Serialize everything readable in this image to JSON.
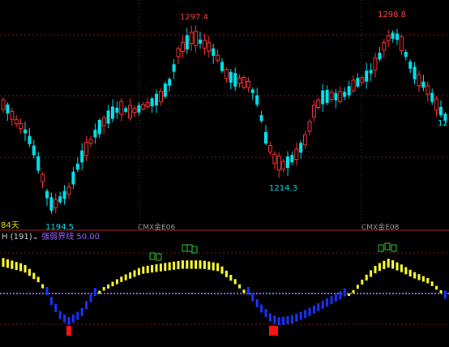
{
  "price_panel": {
    "colors": {
      "up": "#ff3333",
      "down": "#00e5ee",
      "grid": "#8b1a1a",
      "high_label": "#ff4444",
      "low_label": "#00e5ee",
      "days_label": "#e6e600",
      "contract_label": "#999999"
    },
    "price_marks": {
      "high_1": "1297.4",
      "high_2": "1298.8",
      "low_1": "1214.3",
      "low_2": "1194.5",
      "right_edge": "12"
    },
    "days_label": "84天",
    "contract_labels": [
      "CMX金E06",
      "CMX金E08"
    ]
  },
  "indicator_panel": {
    "name": "H",
    "param": "(191)",
    "dropdown_icon": "chevron-down-icon",
    "line_name": "强弱界线",
    "line_value": "50.00",
    "colors": {
      "title": "#dddddd",
      "line": "#9966ff",
      "yellow": "#ffff33",
      "blue": "#1a33ff",
      "green": "#33cc33",
      "red": "#ff1111"
    }
  },
  "chart_data": {
    "type": "candlestick",
    "price_extremes": {
      "high_1": 1297.4,
      "high_2": 1298.8,
      "low_1": 1214.3,
      "low_2": 1194.5
    },
    "indicator": {
      "name": "H",
      "param": 191,
      "reference_line": 50.0
    }
  }
}
